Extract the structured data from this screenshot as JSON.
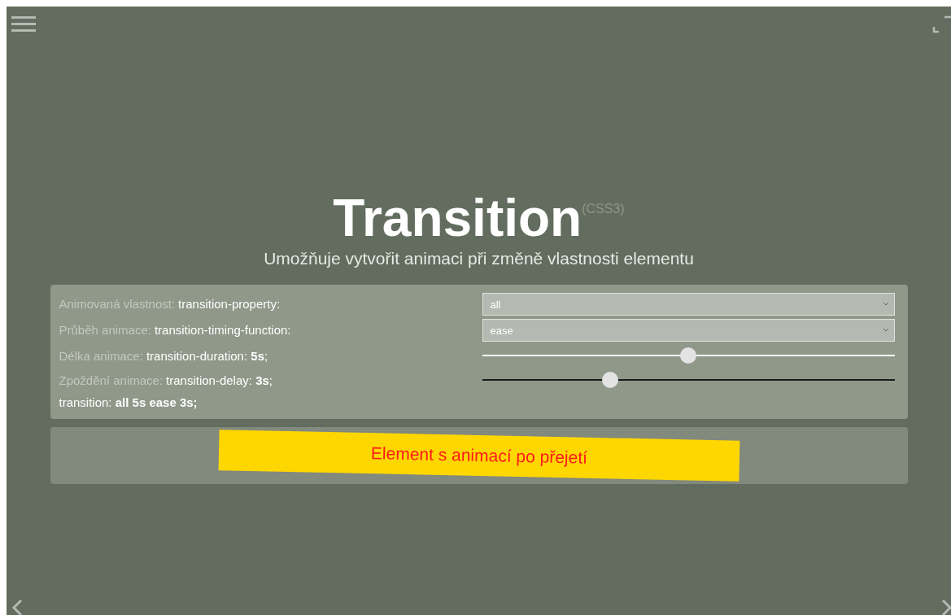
{
  "heading": {
    "title": "Transition",
    "tag": "(CSS3)",
    "subtitle": "Umožňuje vytvořit animaci při změně vlastnosti elementu"
  },
  "settings": [
    {
      "kind": "select",
      "prefix": "Animovaná vlastnost:",
      "code": "transition-property:",
      "value": "all"
    },
    {
      "kind": "select",
      "prefix": "Průběh animace:",
      "code": "transition-timing-function:",
      "value": "ease"
    },
    {
      "kind": "slider",
      "prefix": "Délka animace:",
      "code": "transition-duration: **5s**;",
      "level": 0.5,
      "color": "#ffffff"
    },
    {
      "kind": "slider",
      "prefix": "Zpoždění animace:",
      "code": "transition-delay: **3s**;",
      "level": 0.31,
      "color": "#1a1a1a"
    }
  ],
  "summary": "transition: **all 5s ease 3s;**",
  "demo": {
    "label": "Element s animací po přejetí"
  }
}
